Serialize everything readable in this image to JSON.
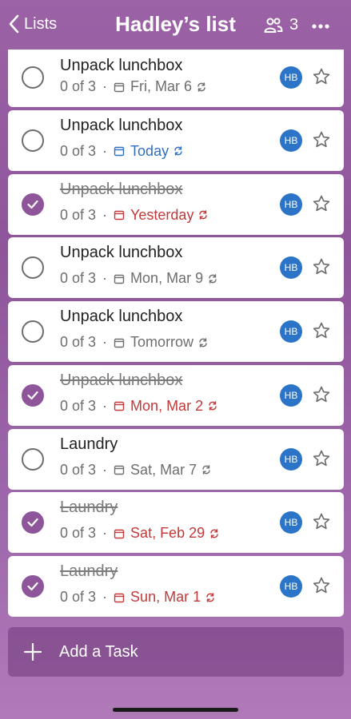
{
  "header": {
    "back_label": "Lists",
    "title": "Hadley’s list",
    "member_count": "3"
  },
  "tasks": [
    {
      "name": "Unpack lunchbox",
      "done": false,
      "steps": "0 of 3",
      "date": "Fri, Mar 6",
      "date_color": "gray",
      "assignee": "HB"
    },
    {
      "name": "Unpack lunchbox",
      "done": false,
      "steps": "0 of 3",
      "date": "Today",
      "date_color": "blue",
      "assignee": "HB"
    },
    {
      "name": "Unpack lunchbox",
      "done": true,
      "steps": "0 of 3",
      "date": "Yesterday",
      "date_color": "red",
      "assignee": "HB"
    },
    {
      "name": "Unpack lunchbox",
      "done": false,
      "steps": "0 of 3",
      "date": "Mon, Mar 9",
      "date_color": "gray",
      "assignee": "HB"
    },
    {
      "name": "Unpack lunchbox",
      "done": false,
      "steps": "0 of 3",
      "date": "Tomorrow",
      "date_color": "gray",
      "assignee": "HB"
    },
    {
      "name": "Unpack lunchbox",
      "done": true,
      "steps": "0 of 3",
      "date": "Mon, Mar 2",
      "date_color": "red",
      "assignee": "HB"
    },
    {
      "name": "Laundry",
      "done": false,
      "steps": "0 of 3",
      "date": "Sat, Mar 7",
      "date_color": "gray",
      "assignee": "HB"
    },
    {
      "name": "Laundry",
      "done": true,
      "steps": "0 of 3",
      "date": "Sat, Feb 29",
      "date_color": "red",
      "assignee": "HB"
    },
    {
      "name": "Laundry",
      "done": true,
      "steps": "0 of 3",
      "date": "Sun, Mar 1",
      "date_color": "red",
      "assignee": "HB"
    }
  ],
  "add_task": {
    "label": "Add a Task"
  },
  "colors": {
    "accent": "#8e559b",
    "avatar": "#2b74c8",
    "date_blue": "#2f6fc4",
    "date_red": "#c33a3a"
  }
}
